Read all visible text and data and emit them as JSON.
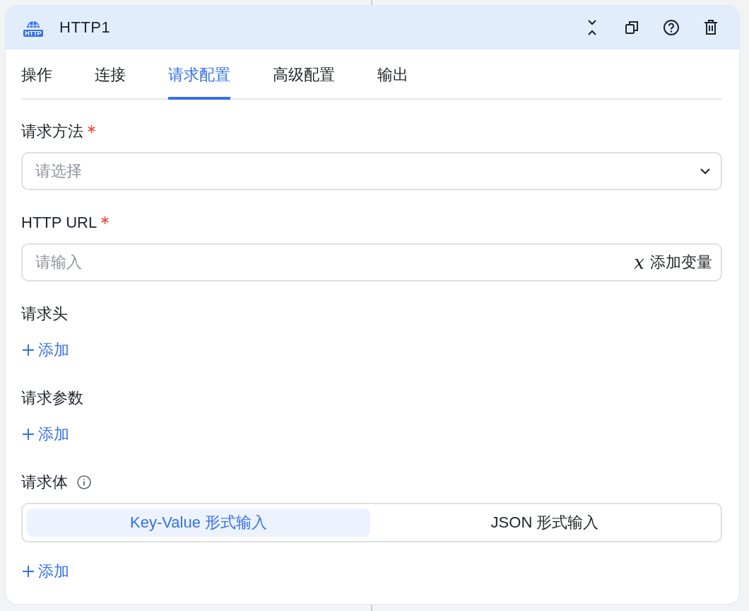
{
  "node": {
    "logo_text": "HTTP",
    "title": "HTTP1"
  },
  "tabs": [
    {
      "label": "操作",
      "selected": false
    },
    {
      "label": "连接",
      "selected": false
    },
    {
      "label": "请求配置",
      "selected": true
    },
    {
      "label": "高级配置",
      "selected": false
    },
    {
      "label": "输出",
      "selected": false
    }
  ],
  "fields": [
    {
      "kind": "select",
      "label": "请求方法",
      "required": true,
      "placeholder": "请选择"
    },
    {
      "kind": "input",
      "label": "HTTP URL",
      "required": true,
      "placeholder": "请输入",
      "variable_symbol": "𝑥",
      "action": "添加变量"
    },
    {
      "kind": "list",
      "label": "请求头",
      "required": false,
      "add": "添加"
    },
    {
      "kind": "list",
      "label": "请求参数",
      "required": false,
      "add": "添加"
    },
    {
      "kind": "segmented",
      "label": "请求体",
      "required": false,
      "info": true,
      "options": [
        {
          "label": "Key-Value 形式输入",
          "selected": true
        },
        {
          "label": "JSON 形式输入",
          "selected": false
        }
      ],
      "add": "添加"
    }
  ]
}
